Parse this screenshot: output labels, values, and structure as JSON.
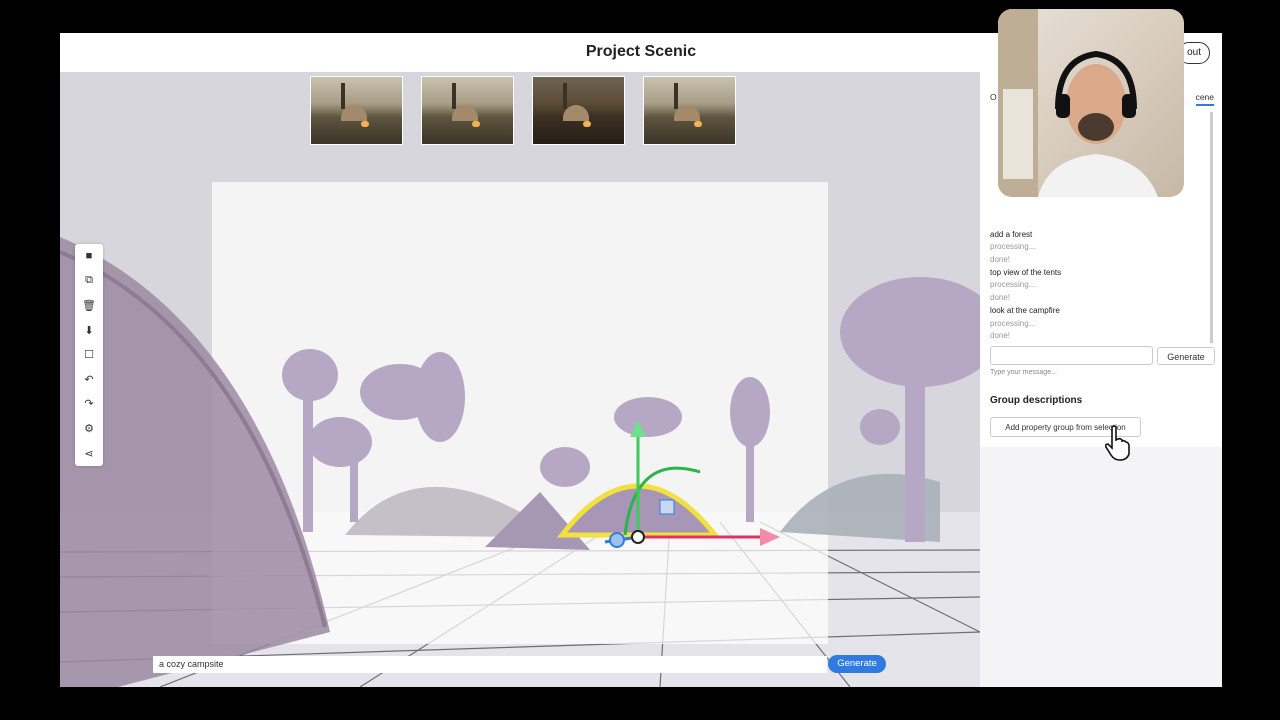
{
  "app": {
    "title": "Project Scenic",
    "sign_out_label": "Sign out",
    "sign_out_visible": "out"
  },
  "thumbnails": [
    {
      "name": "thumbnail-1"
    },
    {
      "name": "thumbnail-2"
    },
    {
      "name": "thumbnail-3"
    },
    {
      "name": "thumbnail-4"
    }
  ],
  "toolbar": {
    "tools": [
      {
        "name": "camera-icon",
        "glyph": "■"
      },
      {
        "name": "duplicate-icon",
        "glyph": "⧉"
      },
      {
        "name": "trash-icon",
        "glyph": "🗑"
      },
      {
        "name": "download-icon",
        "glyph": "⬇"
      },
      {
        "name": "box-icon",
        "glyph": "☐"
      },
      {
        "name": "undo-icon",
        "glyph": "↶"
      },
      {
        "name": "redo-icon",
        "glyph": "↷"
      },
      {
        "name": "settings-icon",
        "glyph": "⚙"
      },
      {
        "name": "share-icon",
        "glyph": "⋖"
      }
    ]
  },
  "prompt": {
    "value": "a cozy campsite",
    "generate_label": "Generate"
  },
  "panel": {
    "tab_left": "O",
    "tab_right": "cene",
    "messages": [
      {
        "text": "add a forest",
        "kind": "user"
      },
      {
        "text": "processing...",
        "kind": "status"
      },
      {
        "text": "done!",
        "kind": "status"
      },
      {
        "text": "top view of the tents",
        "kind": "user"
      },
      {
        "text": "processing...",
        "kind": "status"
      },
      {
        "text": "done!",
        "kind": "status"
      },
      {
        "text": "look at the campfire",
        "kind": "user"
      },
      {
        "text": "processing...",
        "kind": "status"
      },
      {
        "text": "done!",
        "kind": "status"
      }
    ],
    "chat_input_placeholder": "",
    "generate_label": "Generate",
    "hint": "Type your message...",
    "group_title": "Group descriptions",
    "group_button_label": "Add property group from selection"
  },
  "colors": {
    "accent": "#2f7be0",
    "scene_objects": "#b6a8c4",
    "gizmo_yellow": "#f0e040"
  }
}
